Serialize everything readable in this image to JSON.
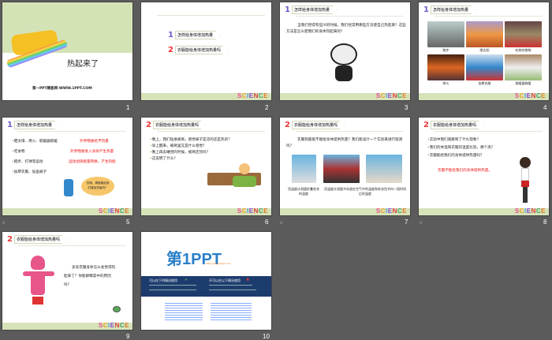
{
  "slides": [
    {
      "number": "1",
      "title": "热起来了",
      "footer": "第一PPT模板网-WWW.1PPT.COM"
    },
    {
      "number": "2",
      "items": [
        "怎样给身体增加热量",
        "衣服能给身体增加热量吗"
      ]
    },
    {
      "number": "3",
      "header": "怎样给身体增加热量",
      "text": "当我们觉得有些冷的时候，我们经常用哪些方法使自己热起来？这些方法是怎么使我们的身体热起来的？"
    },
    {
      "number": "4",
      "header": "怎样给身体增加热量",
      "captions": [
        "跑步",
        "晒太阳",
        "吃热的食物",
        "烤火",
        "加厚衣服",
        "取暖器取暖"
      ]
    },
    {
      "number": "5",
      "header": "怎样给身体增加热量",
      "bullets": [
        "晒太阳、烤火、取暖器取暖",
        "吃食物",
        "跑步、打球等运动",
        "加厚衣服、加盖被子"
      ],
      "notes": [
        "外界物质给予热量",
        "外界物质进入身体产生热量",
        "运动加快能量转换，产生热能"
      ],
      "bubble": "衣服、棉被能给我们增加热量吗？"
    },
    {
      "number": "6",
      "header": "衣服能给身体增加热量吗",
      "bullets": [
        "晚上，我们钻进被窝，感觉被子是凉的还是热的？",
        "早上醒来，被窝里又是什么感觉？",
        "晚上再去睡觉的时候，被窝还热吗？",
        "这说明了什么？"
      ]
    },
    {
      "number": "7",
      "header": "衣服能给身体增加热量吗",
      "text": "衣服到底能不能给身体提供热量？我们能设计一个实验来进行观测吗？",
      "captions": [
        "用温度计测量折叠毛衣的温度",
        "用温度计测量书本放在空气中的温度和毛衣包书内一段时间后的温度"
      ]
    },
    {
      "number": "8",
      "header": "衣服能给身体增加热量吗",
      "bullets": [
        "实验中我们观察到了什么现象？",
        "我们的体温和衣服的温度比较，哪个高？",
        "衣服能给我们的身体提供热量吗？"
      ],
      "answer": "衣服不能给我们的身体提供热量。"
    },
    {
      "number": "9",
      "header": "衣服能给身体增加热量吗",
      "text": "多穿衣服身体怎么会觉得热起来了？你能解释其中的原因吗？"
    },
    {
      "number": "10",
      "logo": "第1PPT",
      "url": "http://www.1ppt.com",
      "can_use": "可以在下列情况使用",
      "cannot_use": "不可以在以下情况使用"
    }
  ],
  "science": [
    "S",
    "C",
    "I",
    "E",
    "N",
    "C",
    "E"
  ],
  "anim_icon": "☆"
}
